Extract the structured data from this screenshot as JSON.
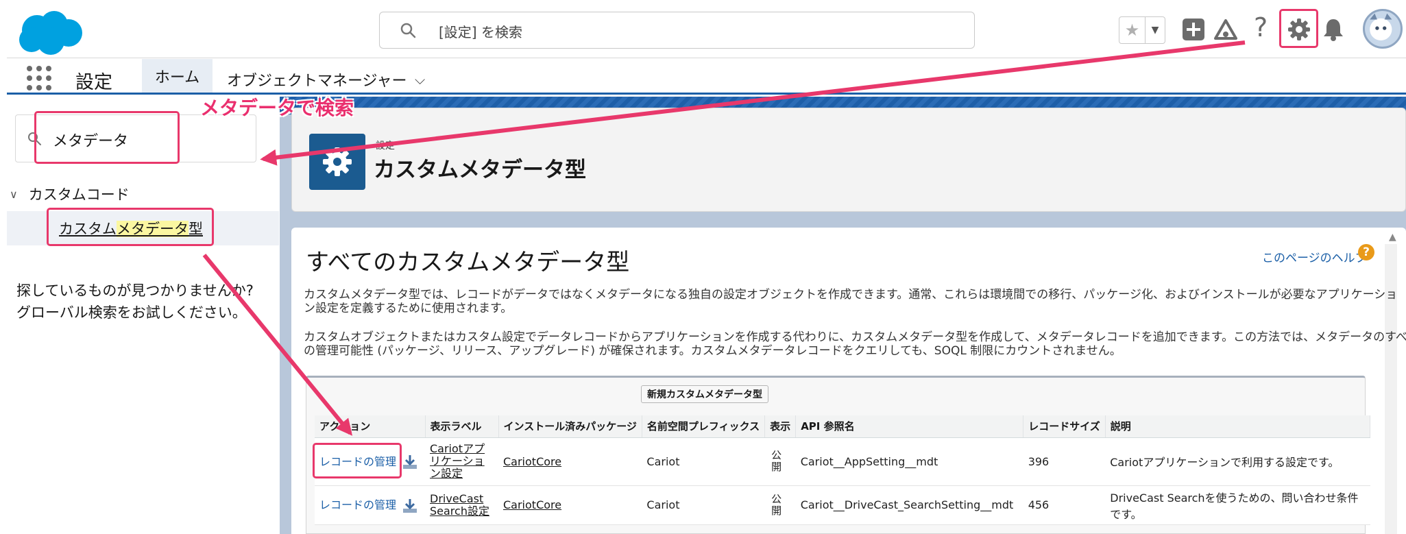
{
  "header": {
    "search_placeholder": "[設定] を検索",
    "icons": [
      "salesforce-cloud-logo",
      "search-icon",
      "favorites-star-icon",
      "add-icon",
      "trailhead-icon",
      "help-icon",
      "gear-icon",
      "bell-icon",
      "avatar"
    ]
  },
  "nav": {
    "app_name": "設定",
    "tabs": [
      {
        "label": "ホーム",
        "active": true
      },
      {
        "label": "オブジェクトマネージャー",
        "active": false
      }
    ]
  },
  "sidebar": {
    "quick_find_value": "メタデータ",
    "tree": {
      "parent": "カスタムコード",
      "child_prefix": "カスタム",
      "child_highlight": "メタデータ",
      "child_suffix": "型"
    },
    "not_found_line1": "探しているものが見つかりませんか?",
    "not_found_line2": "グローバル検索をお試しください。"
  },
  "page_header": {
    "eyebrow": "設定",
    "title": "カスタムメタデータ型"
  },
  "content": {
    "title": "すべてのカスタムメタデータ型",
    "help_link": "このページのヘルプ",
    "help_icon_glyph": "?",
    "desc1_line1": "カスタムメタデータ型では、レコードがデータではなくメタデータになる独自の設定オブジェクトを作成できます。通常、これらは環境間での移行、パッケージ化、およびインストールが必要なアプリケーショ",
    "desc1_line2": "ン設定を定義するために使用されます。",
    "desc2_line1": "カスタムオブジェクトまたはカスタム設定でデータレコードからアプリケーションを作成する代わりに、カスタムメタデータ型を作成して、メタデータレコードを追加できます。この方法では、メタデータのすべて",
    "desc2_line2": "の管理可能性 (パッケージ、リリース、アップグレード) が確保されます。カスタムメタデータレコードをクエリしても、SOQL 制限にカウントされません。",
    "new_button": "新規カスタムメタデータ型",
    "columns": [
      "アクション",
      "表示ラベル",
      "インストール済みパッケージ",
      "名前空間プレフィックス",
      "表示",
      "API 参照名",
      "レコードサイズ",
      "説明"
    ],
    "rows": [
      {
        "action": "レコードの管理",
        "label": "Cariotアプリケーション設定",
        "package": "CariotCore",
        "namespace": "Cariot",
        "visibility": "公開",
        "api": "Cariot__AppSetting__mdt",
        "size": "396",
        "desc": "Cariotアプリケーションで利用する設定です。"
      },
      {
        "action": "レコードの管理",
        "label": "DriveCast Search設定",
        "package": "CariotCore",
        "namespace": "Cariot",
        "visibility": "公開",
        "api": "Cariot__DriveCast_SearchSetting__mdt",
        "size": "456",
        "desc": "DriveCast Searchを使うための、問い合わせ条件です。"
      }
    ]
  },
  "annotation": {
    "label": "メタデータで検索",
    "color": "#ea2f6e"
  }
}
